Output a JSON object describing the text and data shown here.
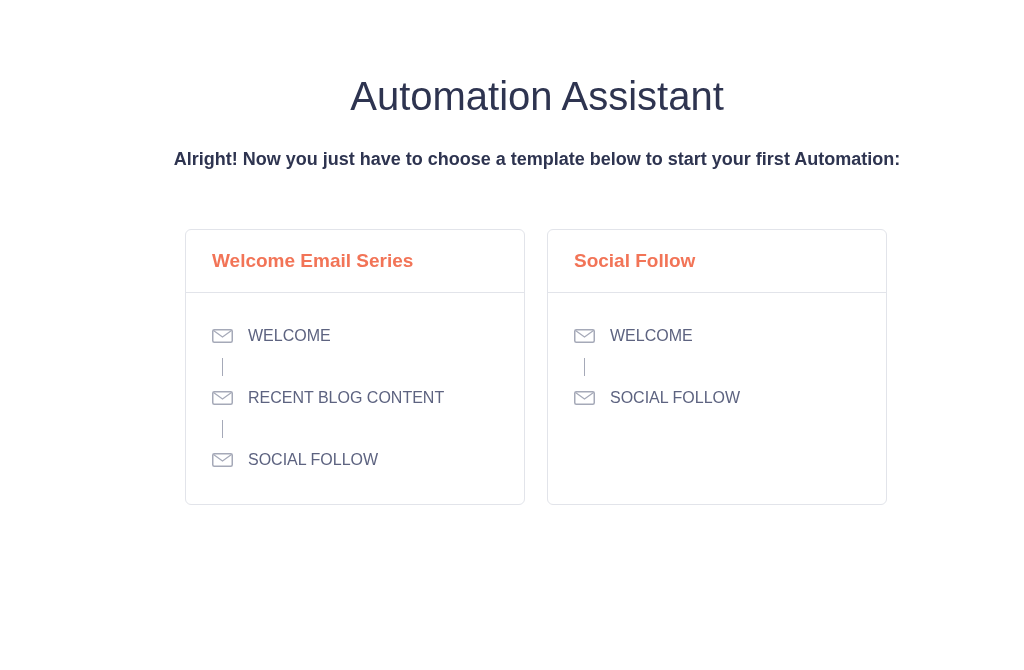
{
  "title": "Automation Assistant",
  "subtitle": "Alright! Now you just have to choose a template below to start your first Automation:",
  "templates": [
    {
      "name": "Welcome Email Series",
      "steps": [
        "WELCOME",
        "RECENT BLOG CONTENT",
        "SOCIAL FOLLOW"
      ]
    },
    {
      "name": "Social Follow",
      "steps": [
        "WELCOME",
        "SOCIAL FOLLOW"
      ]
    }
  ]
}
